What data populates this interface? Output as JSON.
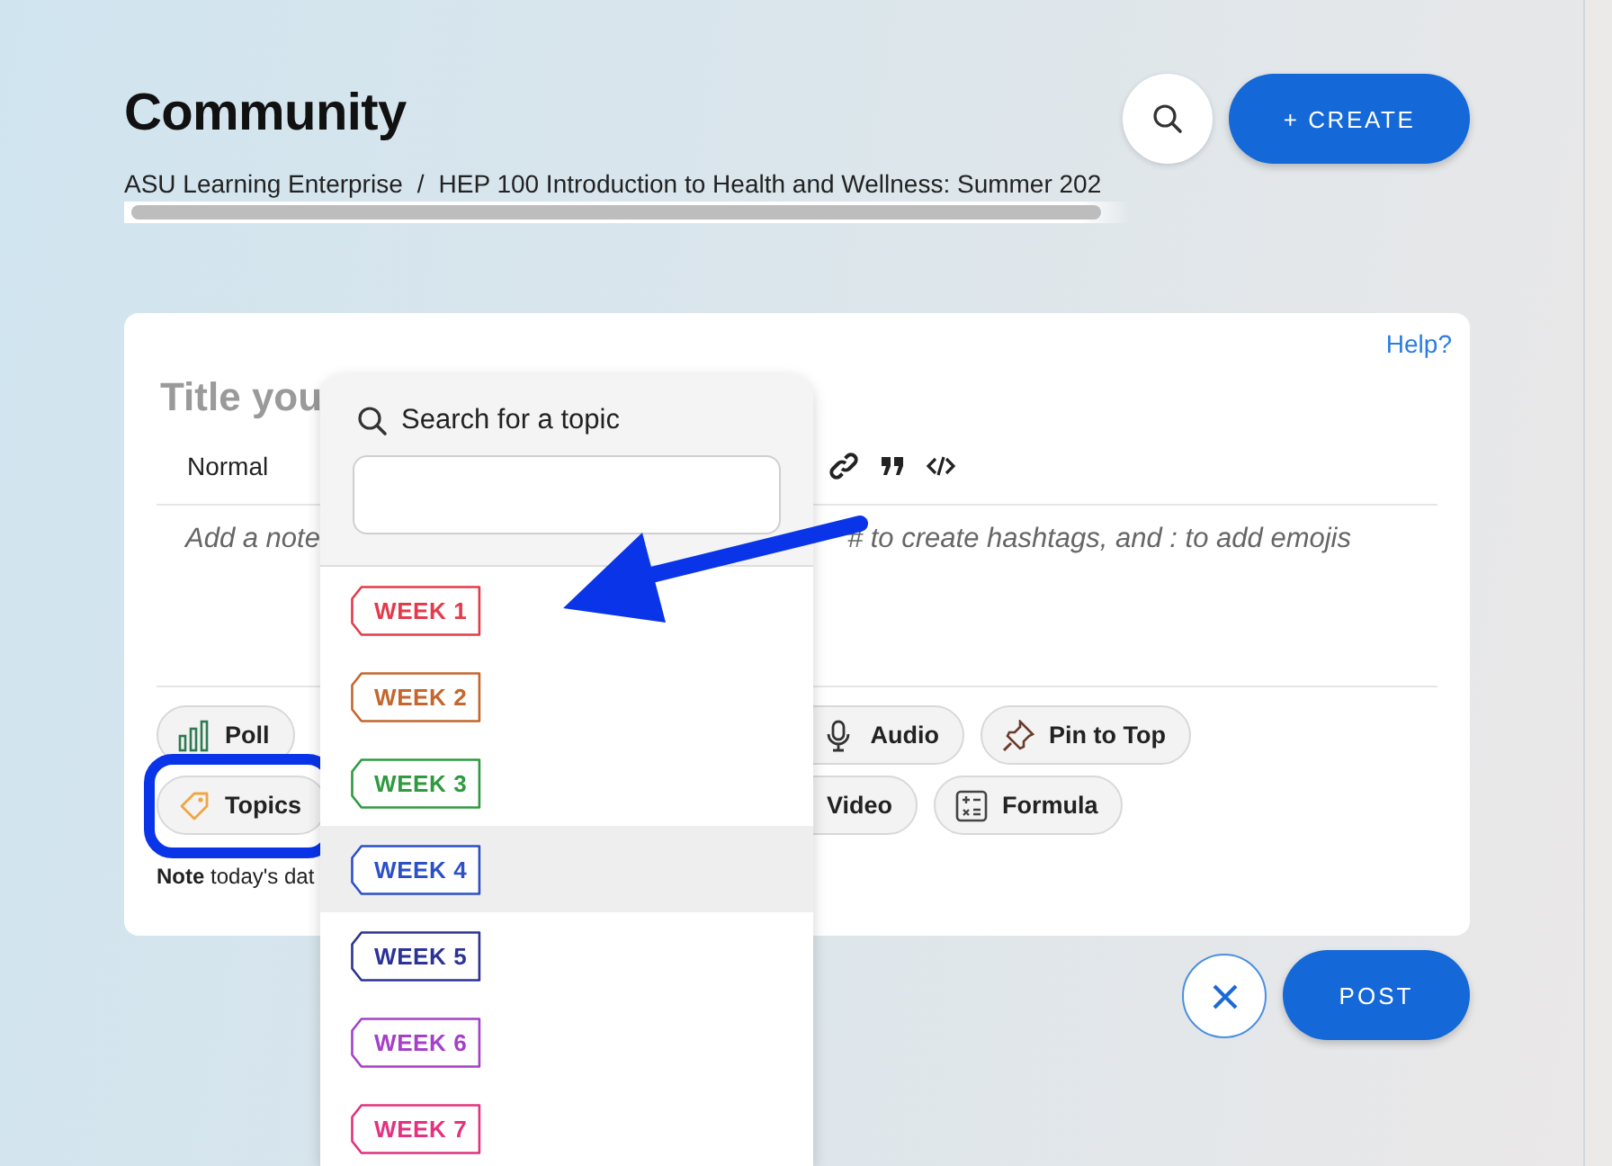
{
  "header": {
    "title": "Community",
    "breadcrumb": [
      "ASU Learning Enterprise",
      "HEP 100 Introduction to Health and Wellness: Summer 202"
    ],
    "breadcrumb_separator": "/",
    "create_button": "+ CREATE"
  },
  "composer": {
    "help_link": "Help?",
    "title_placeholder": "Title you",
    "format_select": "Normal",
    "body_placeholder_parts": [
      "Add a note",
      "# to create hashtags, and : to add emojis"
    ],
    "attachment_rows": [
      {
        "chips": [
          {
            "kind": "poll",
            "label": "Poll"
          },
          {
            "kind": "audio",
            "label": "Audio"
          },
          {
            "kind": "pin",
            "label": "Pin to Top"
          }
        ]
      },
      {
        "chips": [
          {
            "kind": "topics",
            "label": "Topics"
          },
          {
            "kind": "video",
            "label": "Video"
          },
          {
            "kind": "formula",
            "label": "Formula"
          }
        ]
      }
    ],
    "note": "**Note** today's dat",
    "post_button": "POST"
  },
  "topic_menu": {
    "search_label": "Search for a topic",
    "topics": [
      {
        "label": "WEEK 1",
        "color": "#e43b4c",
        "selected": false
      },
      {
        "label": "WEEK 2",
        "color": "#c4662e",
        "selected": false
      },
      {
        "label": "WEEK 3",
        "color": "#2f9a3f",
        "selected": false
      },
      {
        "label": "WEEK 4",
        "color": "#2d50c6",
        "selected": true
      },
      {
        "label": "WEEK 5",
        "color": "#2b3394",
        "selected": false
      },
      {
        "label": "WEEK 6",
        "color": "#a640c9",
        "selected": false
      },
      {
        "label": "WEEK 7",
        "color": "#e3327f",
        "selected": false
      }
    ]
  }
}
